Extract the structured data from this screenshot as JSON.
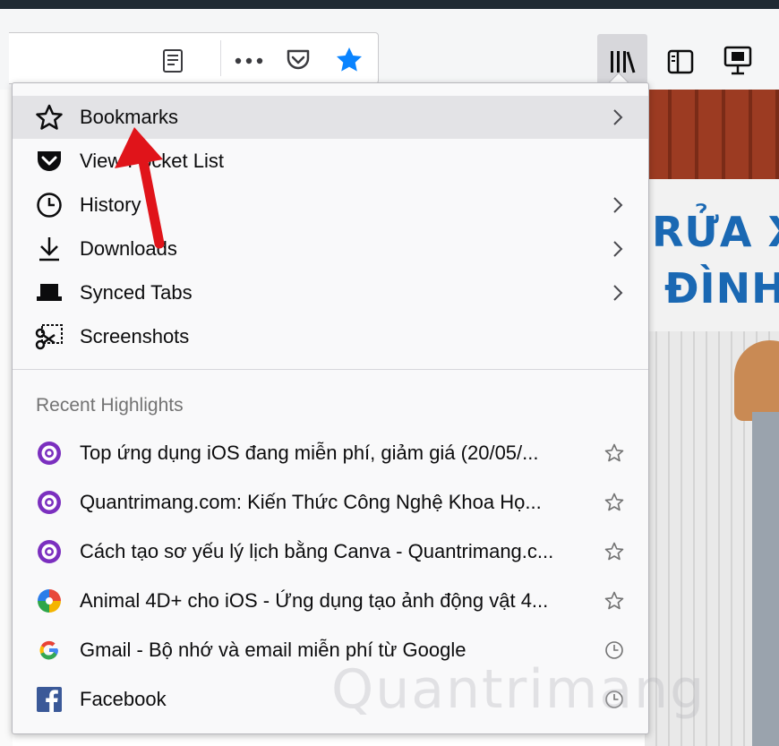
{
  "menu": {
    "items": [
      {
        "label": "Bookmarks",
        "icon": "star-outline-icon",
        "has_submenu": true
      },
      {
        "label": "View Pocket List",
        "icon": "pocket-icon",
        "has_submenu": false
      },
      {
        "label": "History",
        "icon": "clock-icon",
        "has_submenu": true
      },
      {
        "label": "Downloads",
        "icon": "download-arrow-icon",
        "has_submenu": true
      },
      {
        "label": "Synced Tabs",
        "icon": "synced-tabs-icon",
        "has_submenu": true
      },
      {
        "label": "Screenshots",
        "icon": "screenshots-scissors-icon",
        "has_submenu": false
      }
    ]
  },
  "highlights": {
    "title": "Recent Highlights",
    "items": [
      {
        "label": "Top ứng dụng iOS đang miễn phí, giảm giá (20/05/...",
        "icon": "quantrimang-favicon-icon",
        "action": "star-icon"
      },
      {
        "label": "Quantrimang.com: Kiến Thức Công Nghệ Khoa Họ...",
        "icon": "quantrimang-favicon-icon",
        "action": "star-icon"
      },
      {
        "label": "Cách tạo sơ yếu lý lịch bằng Canva - Quantrimang.c...",
        "icon": "quantrimang-favicon-icon",
        "action": "star-icon"
      },
      {
        "label": "Animal 4D+ cho iOS - Ứng dụng tạo ảnh động vật 4...",
        "icon": "colorful-pinwheel-icon",
        "action": "star-icon"
      },
      {
        "label": "Gmail - Bộ nhớ và email miễn phí từ Google",
        "icon": "google-g-icon",
        "action": "clock-icon"
      },
      {
        "label": "Facebook",
        "icon": "facebook-icon",
        "action": "clock-icon"
      }
    ]
  },
  "page_banner": {
    "line1": "RỬA X",
    "line2": "ĐÌNH"
  },
  "watermark": "Quantrimang",
  "colors": {
    "accent_blue": "#0a84ff",
    "purple": "#8a2be2",
    "red_arrow": "#e0141a",
    "banner_blue": "#1a68b3"
  }
}
